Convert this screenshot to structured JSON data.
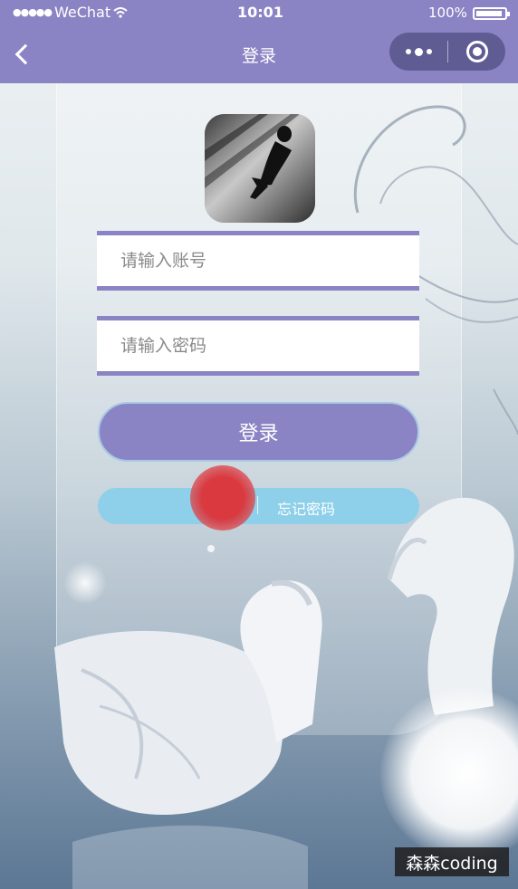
{
  "status_bar": {
    "carrier": "WeChat",
    "time": "10:01",
    "battery": "100%"
  },
  "nav": {
    "title": "登录"
  },
  "form": {
    "account_placeholder": "请输入账号",
    "password_placeholder": "请输入密码",
    "login_label": "登录",
    "forgot_label": "忘记密码"
  },
  "watermark": "森森coding",
  "colors": {
    "nav_bg": "#8b84c4",
    "button_bg": "#8b84c4",
    "links_bg": "#8ed0ea"
  },
  "icons": {
    "back": "chevron-left-icon",
    "more": "more-dots-icon",
    "close": "close-mini-program-icon",
    "wifi": "wifi-icon",
    "battery": "battery-icon"
  }
}
